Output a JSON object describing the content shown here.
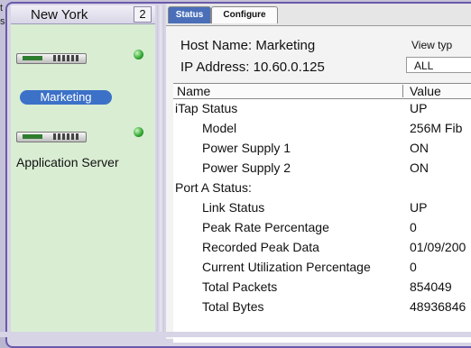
{
  "background": {
    "fragments": [
      "t",
      "s"
    ]
  },
  "left_panel": {
    "title": "New York",
    "count": "2",
    "devices": [
      {
        "label": "Marketing",
        "selected": true,
        "status": "green"
      },
      {
        "label": "Application Server",
        "selected": false,
        "status": "green"
      }
    ]
  },
  "right_panel": {
    "tabs": [
      {
        "label": "Status",
        "active": true
      },
      {
        "label": "Configure",
        "active": false
      }
    ],
    "host_name": "Host Name: Marketing",
    "ip_address": "IP Address: 10.60.0.125",
    "view_type_label": "View typ",
    "view_type_value": "ALL",
    "table": {
      "headers": {
        "name": "Name",
        "value": "Value"
      },
      "rows": [
        {
          "name": "iTap Status",
          "value": "UP",
          "indent": 0
        },
        {
          "name": "Model",
          "value": "256M Fib",
          "indent": 1
        },
        {
          "name": "Power Supply 1",
          "value": "ON",
          "indent": 1
        },
        {
          "name": "Power Supply 2",
          "value": "ON",
          "indent": 1
        },
        {
          "name": "Port A Status:",
          "value": "",
          "indent": 0
        },
        {
          "name": "Link Status",
          "value": "UP",
          "indent": 1
        },
        {
          "name": "Peak Rate Percentage",
          "value": "0",
          "indent": 1
        },
        {
          "name": "Recorded Peak Data",
          "value": "01/09/200",
          "indent": 1
        },
        {
          "name": "Current Utilization Percentage",
          "value": "0",
          "indent": 1
        },
        {
          "name": "Total Packets",
          "value": "854049",
          "indent": 1
        },
        {
          "name": "Total Bytes",
          "value": "48936846",
          "indent": 1
        }
      ]
    }
  }
}
